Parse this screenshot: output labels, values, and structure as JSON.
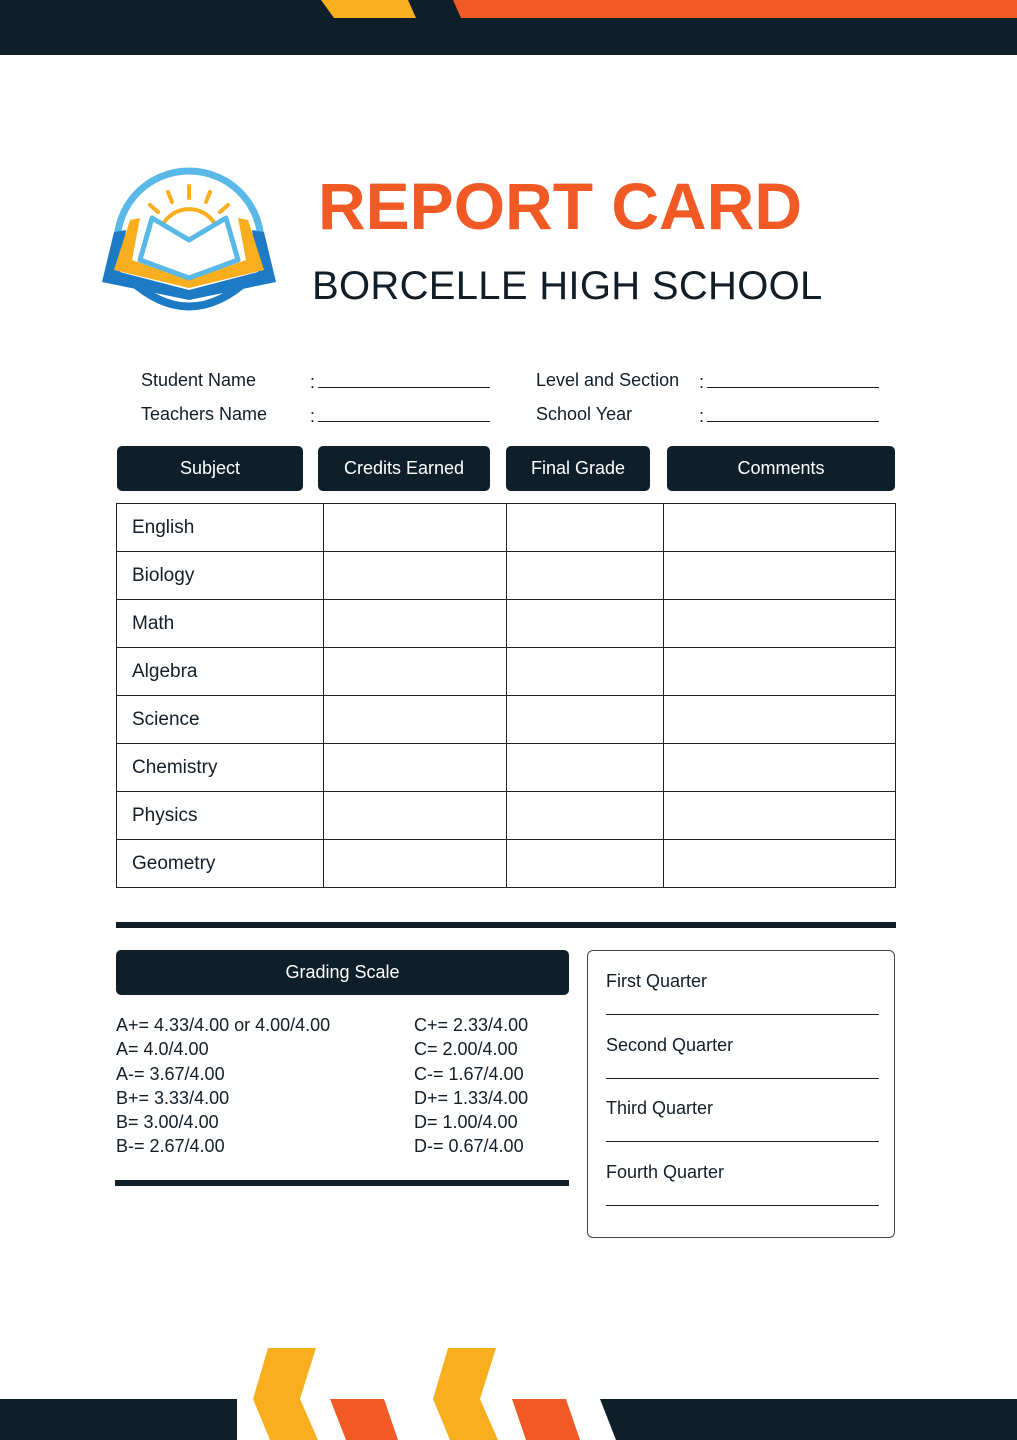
{
  "header": {
    "title": "REPORT CARD",
    "school": "BORCELLE HIGH SCHOOL",
    "logo_icon": "open-book-sun-icon"
  },
  "colors": {
    "navy": "#0f1f2a",
    "orange": "#f15a24",
    "yellow": "#f9ae1e",
    "logo_light_blue": "#5ab8e8",
    "logo_dark_blue": "#1c7bc4"
  },
  "info_fields": [
    {
      "label": "Student Name",
      "value": ""
    },
    {
      "label": "Teachers Name",
      "value": ""
    },
    {
      "label": "Level and Section",
      "value": ""
    },
    {
      "label": "School Year",
      "value": ""
    }
  ],
  "colon": ":",
  "table": {
    "headers": [
      "Subject",
      "Credits Earned",
      "Final Grade",
      "Comments"
    ],
    "rows": [
      {
        "subject": "English",
        "credits": "",
        "grade": "",
        "comments": ""
      },
      {
        "subject": "Biology",
        "credits": "",
        "grade": "",
        "comments": ""
      },
      {
        "subject": "Math",
        "credits": "",
        "grade": "",
        "comments": ""
      },
      {
        "subject": "Algebra",
        "credits": "",
        "grade": "",
        "comments": ""
      },
      {
        "subject": "Science",
        "credits": "",
        "grade": "",
        "comments": ""
      },
      {
        "subject": "Chemistry",
        "credits": "",
        "grade": "",
        "comments": ""
      },
      {
        "subject": "Physics",
        "credits": "",
        "grade": "",
        "comments": ""
      },
      {
        "subject": "Geometry",
        "credits": "",
        "grade": "",
        "comments": ""
      }
    ]
  },
  "grading_scale": {
    "title": "Grading Scale",
    "left": [
      "A+= 4.33/4.00 or 4.00/4.00",
      "A= 4.0/4.00",
      "A-= 3.67/4.00",
      "B+= 3.33/4.00",
      "B= 3.00/4.00",
      "B-= 2.67/4.00"
    ],
    "right": [
      "C+= 2.33/4.00",
      "C= 2.00/4.00",
      "C-= 1.67/4.00",
      "D+= 1.33/4.00",
      "D= 1.00/4.00",
      "D-= 0.67/4.00"
    ]
  },
  "quarters": [
    "First Quarter",
    "Second Quarter",
    "Third Quarter",
    "Fourth Quarter"
  ]
}
